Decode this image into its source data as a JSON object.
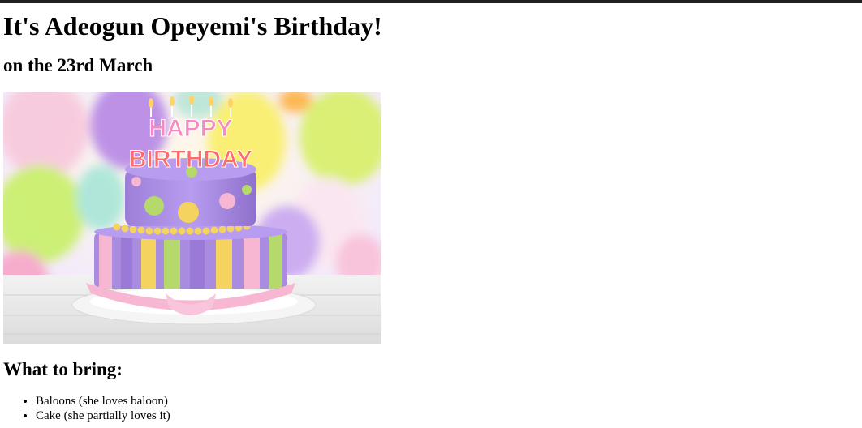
{
  "page": {
    "heading": "It's Adeogun Opeyemi's Birthday!",
    "date": "on the 23rd March",
    "bring_heading": "What to bring:",
    "items": [
      "Baloons (she loves baloon)",
      "Cake (she partially loves it)"
    ]
  },
  "image": {
    "alt": "Happy Birthday cake",
    "candle_text_top": "HAPPY",
    "candle_text_bottom": "BIRTHDAY"
  },
  "colors": {
    "top_bar": "#1f1f1f",
    "cake_purple": "#a98be0",
    "cake_pink": "#f7b6d2",
    "cake_yellow": "#f4d35e",
    "cake_green": "#b5d96b"
  }
}
